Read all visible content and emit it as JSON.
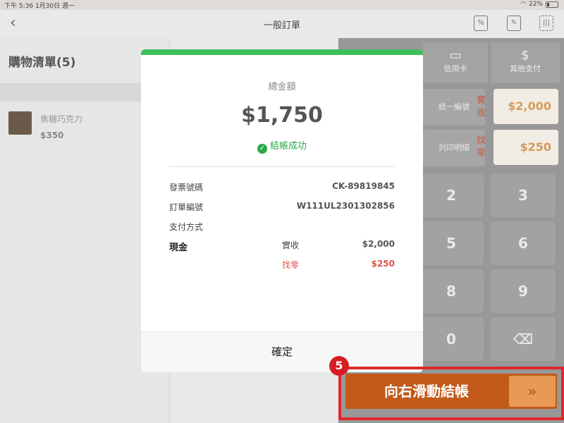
{
  "status": {
    "time": "下午 5:36",
    "date": "1月30日 週一",
    "battery": "22%"
  },
  "header": {
    "title": "一般訂單",
    "icons": [
      "discount-icon",
      "edit-note-icon",
      "barcode-scan-icon"
    ]
  },
  "cart": {
    "title": "購物清單(5)",
    "items": [
      {
        "name": "焦糖巧克力",
        "price": "$350"
      }
    ]
  },
  "payment": {
    "tabs": [
      {
        "label": "信用卡",
        "icon": "credit-card-icon"
      },
      {
        "label": "其他支付",
        "icon": "other-payment-icon"
      }
    ],
    "buttons": [
      "統一編號",
      "列印明細"
    ],
    "received_label": "實收",
    "received_value": "$2,000",
    "change_label": "找零",
    "change_value": "$250",
    "keys": [
      "2",
      "3",
      "5",
      "6",
      "8",
      "9",
      "0",
      "⌫"
    ]
  },
  "modal": {
    "total_label": "總金額",
    "total_amount": "$1,750",
    "success_text": "結帳成功",
    "rows": [
      {
        "label": "發票號碼",
        "value": "CK-89819845"
      },
      {
        "label": "訂單編號",
        "value": "W111UL2301302856"
      },
      {
        "label": "支付方式",
        "value": ""
      }
    ],
    "method": "現金",
    "received_label": "實收",
    "received_value": "$2,000",
    "change_label": "找零",
    "change_value": "$250",
    "confirm_label": "確定"
  },
  "slide": {
    "label": "向右滑動結帳",
    "arrow": "»"
  },
  "annotation": {
    "step": "5"
  },
  "colors": {
    "accent": "#c25a19",
    "success": "#2aa84a",
    "highlight": "#e0282e"
  }
}
